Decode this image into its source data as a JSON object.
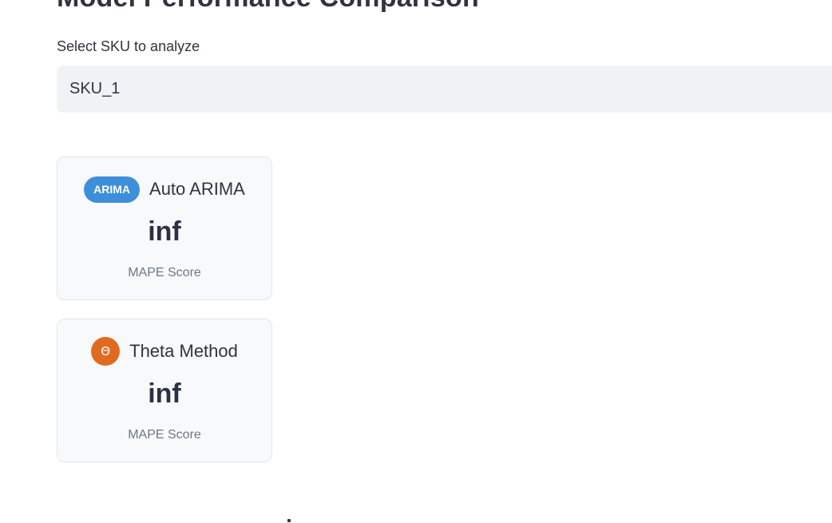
{
  "page": {
    "title": "Model Performance Comparison"
  },
  "selector": {
    "label": "Select SKU to analyze",
    "value": "SKU_1"
  },
  "models": [
    {
      "badge": "ARIMA",
      "name": "Auto ARIMA",
      "score": "inf",
      "score_label": "MAPE Score",
      "badge_color": "#3d8fd9"
    },
    {
      "badge": "Θ",
      "name": "Theta Method",
      "score": "inf",
      "score_label": "MAPE Score",
      "badge_color": "#e06a1f"
    }
  ],
  "colors": {
    "text": "#31333f",
    "select_bg": "#f0f2f6",
    "card_bg": "#f8f9fb",
    "muted": "#6b7788"
  }
}
